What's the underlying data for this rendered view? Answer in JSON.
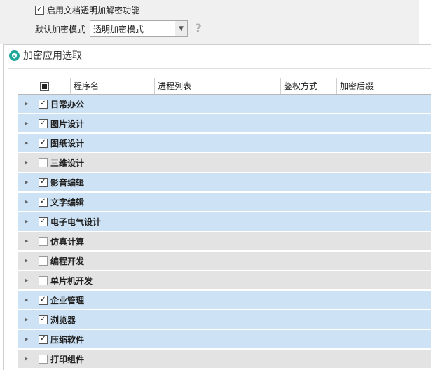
{
  "settings": {
    "enable_label": "启用文档透明加解密功能",
    "enable_checked": true,
    "mode_label": "默认加密模式",
    "mode_value": "透明加密模式",
    "help_symbol": "?"
  },
  "dialog": {
    "title": "加密应用选取"
  },
  "table": {
    "columns": [
      "程序名",
      "进程列表",
      "鉴权方式",
      "加密后缀"
    ],
    "rows": [
      {
        "label": "日常办公",
        "checked": true
      },
      {
        "label": "图片设计",
        "checked": true
      },
      {
        "label": "图纸设计",
        "checked": true
      },
      {
        "label": "三维设计",
        "checked": false
      },
      {
        "label": "影音编辑",
        "checked": true
      },
      {
        "label": "文字编辑",
        "checked": true
      },
      {
        "label": "电子电气设计",
        "checked": true
      },
      {
        "label": "仿真计算",
        "checked": false
      },
      {
        "label": "编程开发",
        "checked": false
      },
      {
        "label": "单片机开发",
        "checked": false
      },
      {
        "label": "企业管理",
        "checked": true
      },
      {
        "label": "浏览器",
        "checked": true
      },
      {
        "label": "压缩软件",
        "checked": true
      },
      {
        "label": "打印组件",
        "checked": false
      }
    ]
  },
  "colors": {
    "row_checked_bg": "#cde3f5",
    "row_unchecked_bg": "#e3e3e3",
    "accent": "#1fa79a"
  },
  "icons": {
    "expander": "chevron-right-icon",
    "app": "shield-icon",
    "select": "chevron-down-icon",
    "help": "question-icon"
  }
}
